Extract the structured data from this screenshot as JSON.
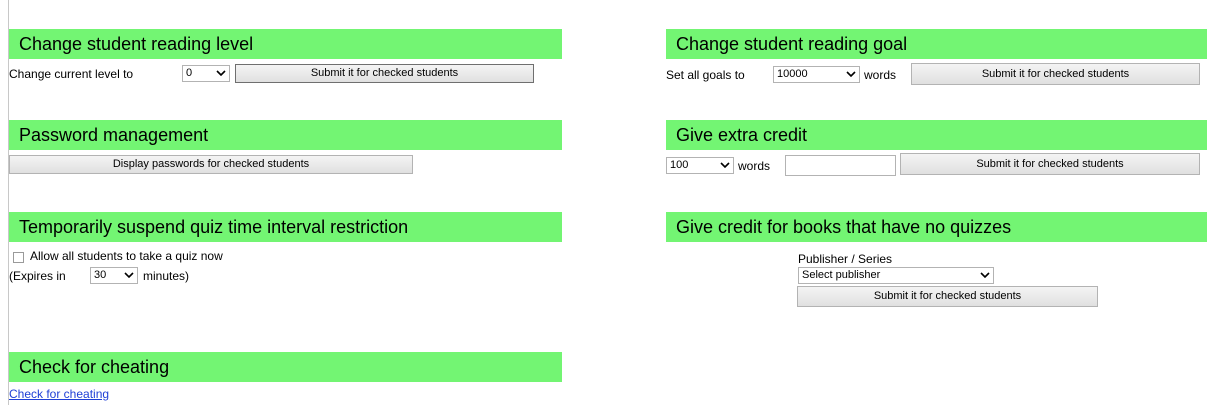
{
  "left": {
    "reading_level": {
      "title": "Change student reading level",
      "prefix": "Change current level to",
      "select_value": "0",
      "button": "Submit it for checked students"
    },
    "password": {
      "title": "Password management",
      "button": "Display passwords for checked students"
    },
    "quiz_interval": {
      "title": "Temporarily suspend quiz time interval restriction",
      "checkbox_label": "Allow all students to take a quiz now",
      "expires_prefix": "(Expires in",
      "expires_value": "30",
      "expires_suffix": "minutes)"
    },
    "cheating": {
      "title": "Check for cheating",
      "link": "Check for cheating"
    }
  },
  "right": {
    "reading_goal": {
      "title": "Change student reading goal",
      "prefix": "Set all goals to",
      "select_value": "10000",
      "suffix": "words",
      "button": "Submit it for checked students"
    },
    "extra_credit": {
      "title": "Give extra credit",
      "select_value": "100",
      "suffix": "words",
      "button": "Submit it for checked students"
    },
    "no_quiz_books": {
      "title": "Give credit for books that have no quizzes",
      "publisher_label": "Publisher / Series",
      "publisher_select": "Select publisher",
      "button": "Submit it for checked students"
    }
  },
  "icons": {
    "dropdown": "chevron-down-icon"
  },
  "colors": {
    "header_bg": "#73f573",
    "link": "#1f3fd6"
  }
}
